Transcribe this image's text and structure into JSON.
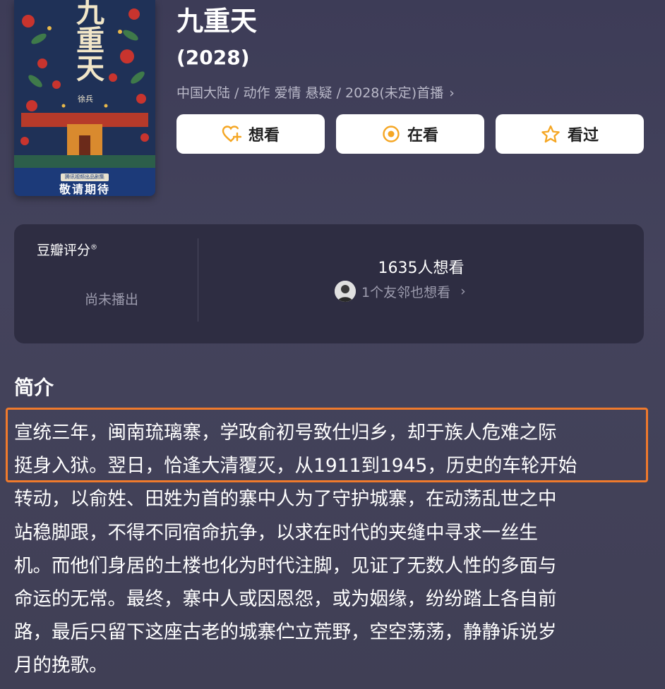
{
  "poster": {
    "title": "九重天",
    "author": "徐兵",
    "small_tag": "腾讯视频出品剧集",
    "tagline": "敬请期待"
  },
  "movie": {
    "title": "九重天",
    "year": "(2028)",
    "meta": "中国大陆 / 动作 爱情 悬疑 / 2028(未定)首播"
  },
  "actions": {
    "want": "想看",
    "watching": "在看",
    "watched": "看过"
  },
  "rating": {
    "label": "豆瓣评分",
    "registered": "®",
    "status": "尚未播出",
    "want_count": "1635人想看",
    "friends": "1个友邻也想看"
  },
  "synopsis": {
    "heading": "简介",
    "lines": [
      "宣统三年，闽南琉璃寨，学政俞初号致仕归乡，却于族人危难之际",
      "挺身入狱。翌日，恰逢大清覆灭，从1911到1945，历史的车轮开始",
      "转动，以俞姓、田姓为首的寨中人为了守护城寨，在动荡乱世之中",
      "站稳脚跟，不得不同宿命抗争，以求在时代的夹缝中寻求一丝生",
      "机。而他们身居的土楼也化为时代注脚，见证了无数人性的多面与",
      "命运的无常。最终，寨中人或因恩怨，或为姻缘，纷纷踏上各自前",
      "路，最后只留下这座古老的城寨伫立荒野，空空荡荡，静静诉说岁",
      "月的挽歌。"
    ]
  },
  "colors": {
    "highlight": "#f07a2c",
    "accent": "#f5a623"
  }
}
